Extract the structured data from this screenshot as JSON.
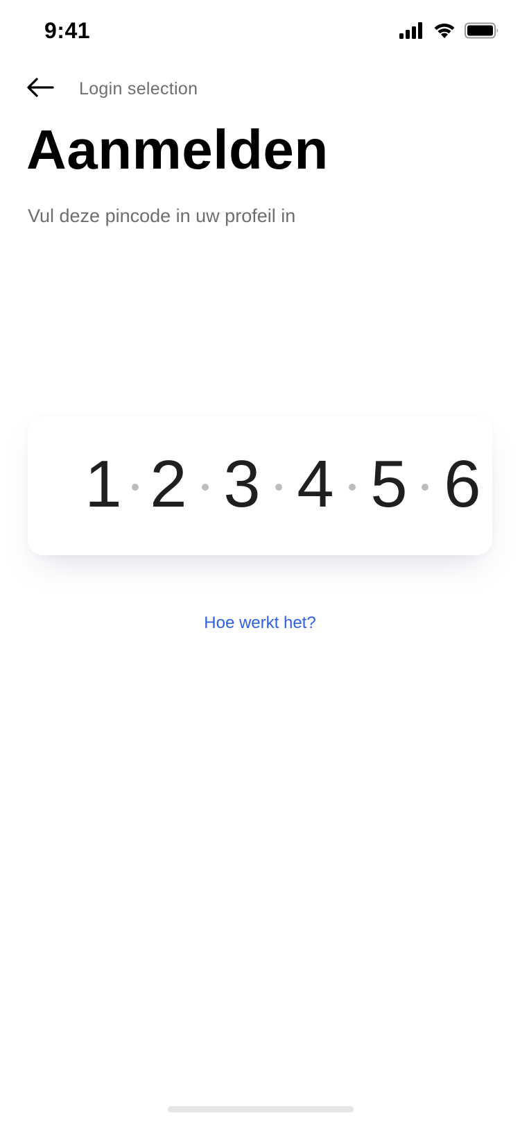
{
  "status_bar": {
    "time": "9:41",
    "icons": [
      "cellular-signal-icon",
      "wifi-icon",
      "battery-icon"
    ]
  },
  "header": {
    "back_icon": "arrow-left-icon",
    "title": "Login selection"
  },
  "main": {
    "title": "Aanmelden",
    "subtitle": "Vul deze pincode in uw profeil in",
    "pincode": [
      "1",
      "2",
      "3",
      "4",
      "5",
      "6"
    ],
    "help_link": "Hoe werkt het?"
  },
  "colors": {
    "link": "#2f5fe6",
    "secondary_text": "#6e6e6e",
    "digit": "#1f1f21"
  }
}
